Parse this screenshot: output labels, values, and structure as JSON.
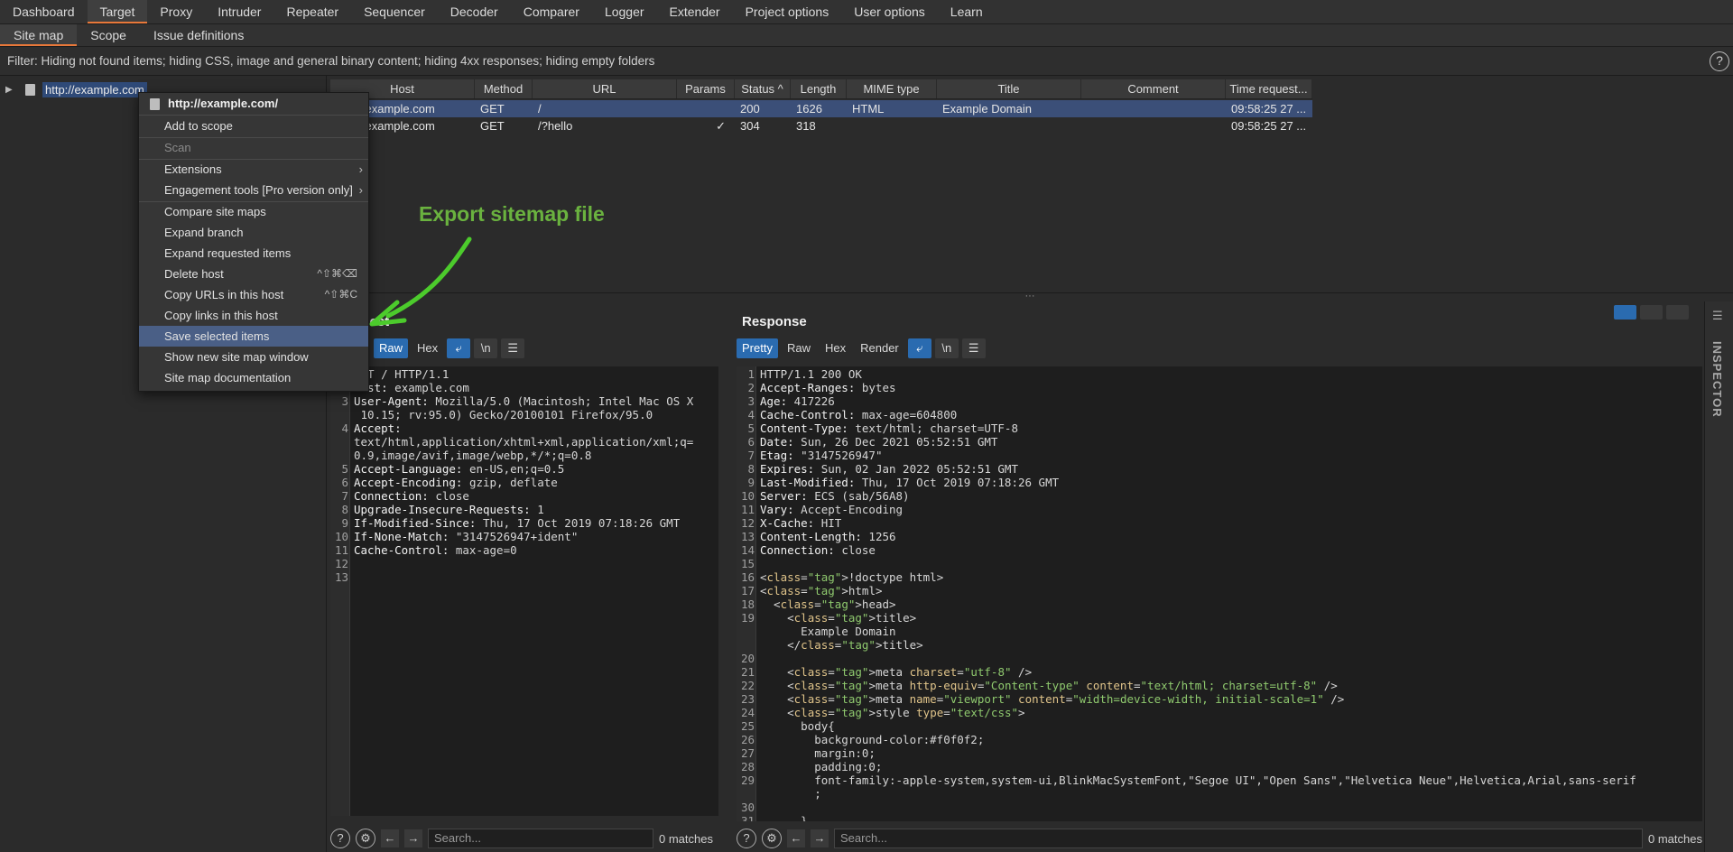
{
  "main_tabs": [
    "Dashboard",
    "Target",
    "Proxy",
    "Intruder",
    "Repeater",
    "Sequencer",
    "Decoder",
    "Comparer",
    "Logger",
    "Extender",
    "Project options",
    "User options",
    "Learn"
  ],
  "sub_tabs": [
    "Site map",
    "Scope",
    "Issue definitions"
  ],
  "filter_text": "Filter: Hiding not found items;  hiding CSS, image and general binary content;  hiding 4xx responses;  hiding empty folders",
  "help_glyph": "?",
  "tree": {
    "label": "http://example.com"
  },
  "table": {
    "columns": [
      "Host",
      "Method",
      "URL",
      "Params",
      "Status ^",
      "Length",
      "MIME type",
      "Title",
      "Comment",
      "Time request..."
    ],
    "rows": [
      [
        "http://example.com",
        "GET",
        "/",
        "",
        "200",
        "1626",
        "HTML",
        "Example Domain",
        "",
        "09:58:25 27 ..."
      ],
      [
        "http://example.com",
        "GET",
        "/?hello",
        "✓",
        "304",
        "318",
        "",
        "",
        "",
        "09:58:25 27 ..."
      ]
    ]
  },
  "context_menu": {
    "header": "http://example.com/",
    "items": [
      {
        "label": "Add to scope"
      },
      {
        "label": "Scan",
        "disabled": true
      },
      {
        "label": "Extensions",
        "submenu": true
      },
      {
        "label": "Engagement tools [Pro version only]",
        "submenu": true
      },
      {
        "label": "Compare site maps"
      },
      {
        "label": "Expand branch"
      },
      {
        "label": "Expand requested items"
      },
      {
        "label": "Delete host",
        "shortcut": "^⇧⌘⌫"
      },
      {
        "label": "Copy URLs in this host",
        "shortcut": "^⇧⌘C"
      },
      {
        "label": "Copy links in this host"
      },
      {
        "label": "Save selected items",
        "highlighted": true
      },
      {
        "label": "Show new site map window"
      },
      {
        "label": "Site map documentation"
      }
    ]
  },
  "annotation": "Export sitemap file",
  "request": {
    "title": "Request",
    "toolbar": [
      "Raw",
      "Hex"
    ],
    "search_placeholder": "Search...",
    "matches": "0 matches",
    "lines": [
      "GET / HTTP/1.1",
      "Host: example.com",
      "User-Agent: Mozilla/5.0 (Macintosh; Intel Mac OS X",
      " 10.15; rv:95.0) Gecko/20100101 Firefox/95.0",
      "Accept:",
      "text/html,application/xhtml+xml,application/xml;q=",
      "0.9,image/avif,image/webp,*/*;q=0.8",
      "Accept-Language: en-US,en;q=0.5",
      "Accept-Encoding: gzip, deflate",
      "Connection: close",
      "Upgrade-Insecure-Requests: 1",
      "If-Modified-Since: Thu, 17 Oct 2019 07:18:26 GMT",
      "If-None-Match: \"3147526947+ident\"",
      "Cache-Control: max-age=0",
      "",
      ""
    ],
    "line_numbers": [
      "1",
      "2",
      "3",
      "",
      "4",
      "",
      "",
      "5",
      "6",
      "7",
      "8",
      "9",
      "10",
      "11",
      "12",
      "13"
    ]
  },
  "response": {
    "title": "Response",
    "toolbar": [
      "Pretty",
      "Raw",
      "Hex",
      "Render"
    ],
    "search_placeholder": "Search...",
    "matches": "0 matches",
    "line_numbers": [
      "1",
      "2",
      "3",
      "4",
      "5",
      "6",
      "7",
      "8",
      "9",
      "10",
      "11",
      "12",
      "13",
      "14",
      "15",
      "16",
      "17",
      "18",
      "19",
      "",
      "",
      "20",
      "21",
      "22",
      "23",
      "24",
      "25",
      "26",
      "27",
      "28",
      "29",
      "",
      "30",
      "31"
    ],
    "lines": [
      "HTTP/1.1 200 OK",
      "Accept-Ranges: bytes",
      "Age: 417226",
      "Cache-Control: max-age=604800",
      "Content-Type: text/html; charset=UTF-8",
      "Date: Sun, 26 Dec 2021 05:52:51 GMT",
      "Etag: \"3147526947\"",
      "Expires: Sun, 02 Jan 2022 05:52:51 GMT",
      "Last-Modified: Thu, 17 Oct 2019 07:18:26 GMT",
      "Server: ECS (sab/56A8)",
      "Vary: Accept-Encoding",
      "X-Cache: HIT",
      "Content-Length: 1256",
      "Connection: close",
      "",
      "<!doctype html>",
      "<html>",
      "  <head>",
      "    <title>",
      "      Example Domain",
      "    </title>",
      "",
      "    <meta charset=\"utf-8\" />",
      "    <meta http-equiv=\"Content-type\" content=\"text/html; charset=utf-8\" />",
      "    <meta name=\"viewport\" content=\"width=device-width, initial-scale=1\" />",
      "    <style type=\"text/css\">",
      "      body{",
      "        background-color:#f0f0f2;",
      "        margin:0;",
      "        padding:0;",
      "        font-family:-apple-system,system-ui,BlinkMacSystemFont,\"Segoe UI\",\"Open Sans\",\"Helvetica Neue\",Helvetica,Arial,sans-serif",
      "        ;",
      "",
      "      }"
    ]
  },
  "inspector_label": "INSPECTOR",
  "colors": {
    "accent_tab": "#e8783a",
    "selection": "#3b4f78",
    "annotation": "#6ab23f",
    "button_blue": "#2a6bb0"
  }
}
